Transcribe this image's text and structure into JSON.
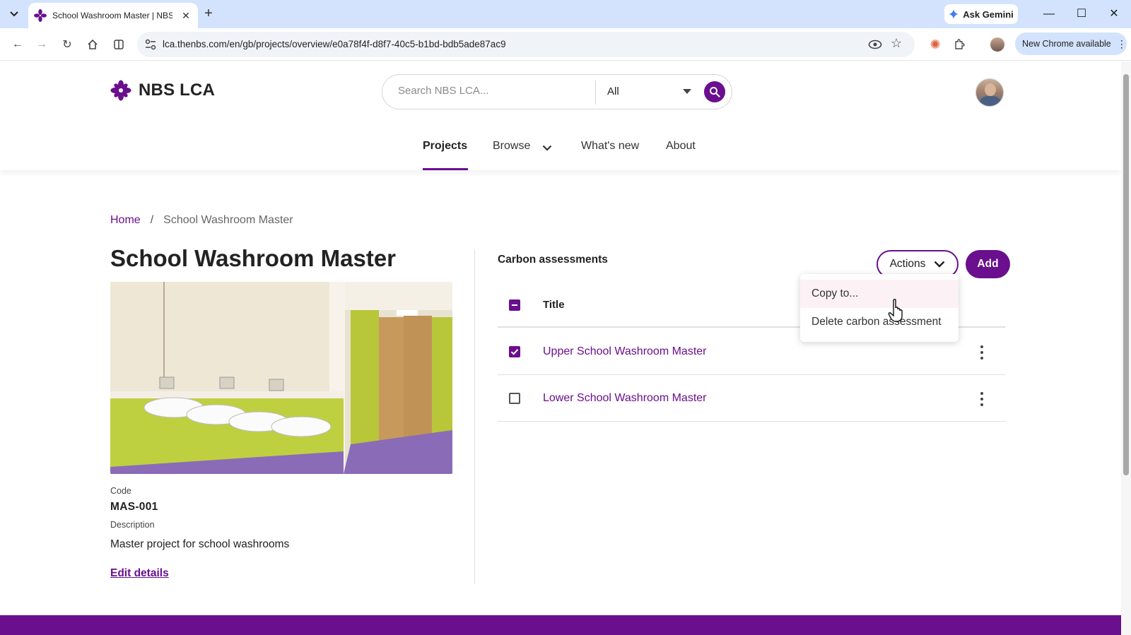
{
  "browser": {
    "tab_title": "School Washroom Master | NBS",
    "url": "lca.thenbs.com/en/gb/projects/overview/e0a78f4f-d8f7-40c5-b1bd-bdb5ade87ac9",
    "gemini_label": "Ask Gemini",
    "update_label": "New Chrome available"
  },
  "header": {
    "logo_text": "NBS LCA",
    "search_placeholder": "Search NBS LCA...",
    "search_scope": "All"
  },
  "nav": {
    "projects": "Projects",
    "browse": "Browse",
    "whats_new": "What's new",
    "about": "About"
  },
  "breadcrumb": {
    "home": "Home",
    "separator": "/",
    "current": "School Washroom Master"
  },
  "project": {
    "title": "School Washroom Master",
    "code_label": "Code",
    "code_value": "MAS-001",
    "description_label": "Description",
    "description_value": "Master project for school washrooms",
    "edit_label": "Edit details"
  },
  "assessments": {
    "section_title": "Carbon assessments",
    "actions_label": "Actions",
    "add_label": "Add",
    "column_title": "Title",
    "rows": [
      {
        "title": "Upper School Washroom Master",
        "checked": true
      },
      {
        "title": "Lower School Washroom Master",
        "checked": false
      }
    ]
  },
  "actions_menu": {
    "items": [
      "Copy to...",
      "Delete carbon assessment"
    ]
  },
  "colors": {
    "brand": "#6a0f8e",
    "menu_hover": "#fcf1f5"
  }
}
